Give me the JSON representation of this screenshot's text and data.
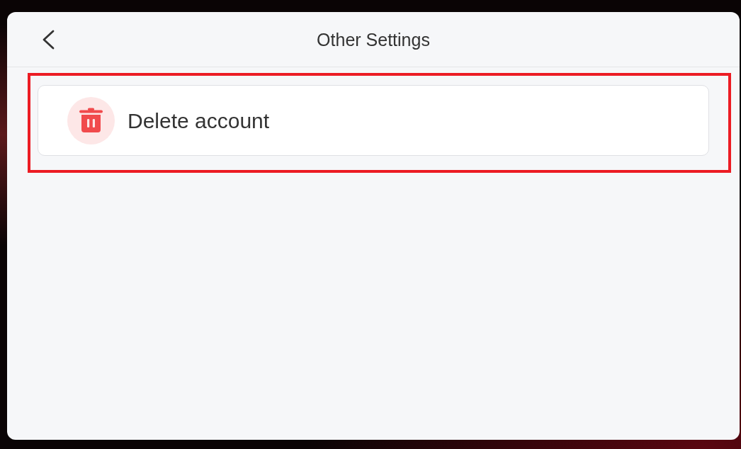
{
  "header": {
    "title": "Other Settings"
  },
  "items": [
    {
      "label": "Delete account",
      "highlighted": true
    }
  ]
}
